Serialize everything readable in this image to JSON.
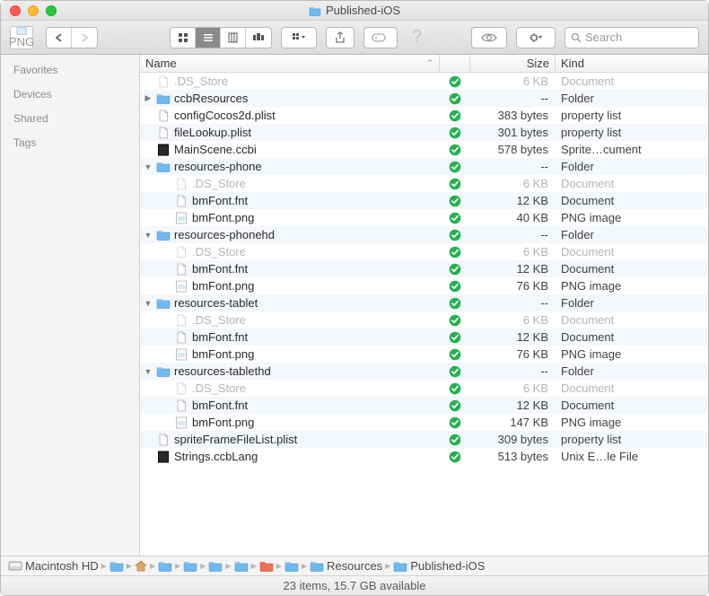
{
  "window": {
    "title": "Published-iOS"
  },
  "search": {
    "placeholder": "Search"
  },
  "sidebar": {
    "items": [
      "Favorites",
      "Devices",
      "Shared",
      "Tags"
    ]
  },
  "columns": {
    "name": "Name",
    "size": "Size",
    "kind": "Kind"
  },
  "rows": [
    {
      "depth": 0,
      "disc": "",
      "icon": "doc-dim",
      "name": ".DS_Store",
      "dim": true,
      "size": "6 KB",
      "kind": "Document"
    },
    {
      "depth": 0,
      "disc": "▶",
      "icon": "folder",
      "name": "ccbResources",
      "dim": false,
      "size": "--",
      "kind": "Folder"
    },
    {
      "depth": 0,
      "disc": "",
      "icon": "doc",
      "name": "configCocos2d.plist",
      "dim": false,
      "size": "383 bytes",
      "kind": "property list"
    },
    {
      "depth": 0,
      "disc": "",
      "icon": "doc",
      "name": "fileLookup.plist",
      "dim": false,
      "size": "301 bytes",
      "kind": "property list"
    },
    {
      "depth": 0,
      "disc": "",
      "icon": "dark",
      "name": "MainScene.ccbi",
      "dim": false,
      "size": "578 bytes",
      "kind": "Sprite…cument"
    },
    {
      "depth": 0,
      "disc": "▼",
      "icon": "folder",
      "name": "resources-phone",
      "dim": false,
      "size": "--",
      "kind": "Folder"
    },
    {
      "depth": 1,
      "disc": "",
      "icon": "doc-dim",
      "name": ".DS_Store",
      "dim": true,
      "size": "6 KB",
      "kind": "Document"
    },
    {
      "depth": 1,
      "disc": "",
      "icon": "doc",
      "name": "bmFont.fnt",
      "dim": false,
      "size": "12 KB",
      "kind": "Document"
    },
    {
      "depth": 1,
      "disc": "",
      "icon": "png",
      "name": "bmFont.png",
      "dim": false,
      "size": "40 KB",
      "kind": "PNG image"
    },
    {
      "depth": 0,
      "disc": "▼",
      "icon": "folder",
      "name": "resources-phonehd",
      "dim": false,
      "size": "--",
      "kind": "Folder"
    },
    {
      "depth": 1,
      "disc": "",
      "icon": "doc-dim",
      "name": ".DS_Store",
      "dim": true,
      "size": "6 KB",
      "kind": "Document"
    },
    {
      "depth": 1,
      "disc": "",
      "icon": "doc",
      "name": "bmFont.fnt",
      "dim": false,
      "size": "12 KB",
      "kind": "Document"
    },
    {
      "depth": 1,
      "disc": "",
      "icon": "png",
      "name": "bmFont.png",
      "dim": false,
      "size": "76 KB",
      "kind": "PNG image"
    },
    {
      "depth": 0,
      "disc": "▼",
      "icon": "folder",
      "name": "resources-tablet",
      "dim": false,
      "size": "--",
      "kind": "Folder"
    },
    {
      "depth": 1,
      "disc": "",
      "icon": "doc-dim",
      "name": ".DS_Store",
      "dim": true,
      "size": "6 KB",
      "kind": "Document"
    },
    {
      "depth": 1,
      "disc": "",
      "icon": "doc",
      "name": "bmFont.fnt",
      "dim": false,
      "size": "12 KB",
      "kind": "Document"
    },
    {
      "depth": 1,
      "disc": "",
      "icon": "png",
      "name": "bmFont.png",
      "dim": false,
      "size": "76 KB",
      "kind": "PNG image"
    },
    {
      "depth": 0,
      "disc": "▼",
      "icon": "folder",
      "name": "resources-tablethd",
      "dim": false,
      "size": "--",
      "kind": "Folder"
    },
    {
      "depth": 1,
      "disc": "",
      "icon": "doc-dim",
      "name": ".DS_Store",
      "dim": true,
      "size": "6 KB",
      "kind": "Document"
    },
    {
      "depth": 1,
      "disc": "",
      "icon": "doc",
      "name": "bmFont.fnt",
      "dim": false,
      "size": "12 KB",
      "kind": "Document"
    },
    {
      "depth": 1,
      "disc": "",
      "icon": "png",
      "name": "bmFont.png",
      "dim": false,
      "size": "147 KB",
      "kind": "PNG image"
    },
    {
      "depth": 0,
      "disc": "",
      "icon": "doc",
      "name": "spriteFrameFileList.plist",
      "dim": false,
      "size": "309 bytes",
      "kind": "property list"
    },
    {
      "depth": 0,
      "disc": "",
      "icon": "dark",
      "name": "Strings.ccbLang",
      "dim": false,
      "size": "513 bytes",
      "kind": "Unix E…le File"
    }
  ],
  "path": [
    {
      "icon": "disk",
      "label": "Macintosh HD"
    },
    {
      "icon": "folder",
      "label": ""
    },
    {
      "icon": "home",
      "label": ""
    },
    {
      "icon": "folder",
      "label": ""
    },
    {
      "icon": "folder",
      "label": ""
    },
    {
      "icon": "folder",
      "label": ""
    },
    {
      "icon": "folder",
      "label": ""
    },
    {
      "icon": "folder-red",
      "label": ""
    },
    {
      "icon": "folder",
      "label": ""
    },
    {
      "icon": "folder",
      "label": "Resources"
    },
    {
      "icon": "folder",
      "label": "Published-iOS"
    }
  ],
  "status": "23 items, 15.7 GB available"
}
